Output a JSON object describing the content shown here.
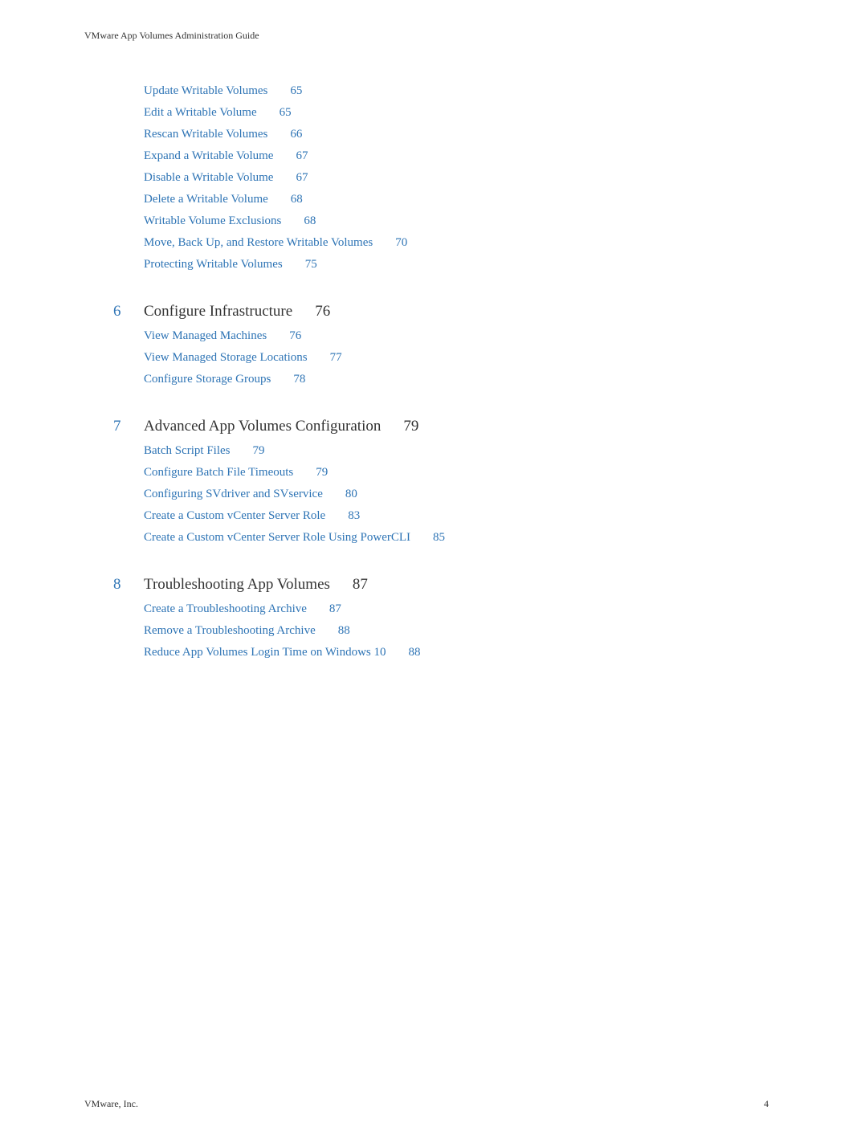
{
  "header": "VMware App Volumes Administration Guide",
  "orphan_items": [
    {
      "title": "Update Writable Volumes",
      "page": "65"
    },
    {
      "title": "Edit a Writable Volume",
      "page": "65"
    },
    {
      "title": "Rescan Writable Volumes",
      "page": "66"
    },
    {
      "title": "Expand a Writable Volume",
      "page": "67"
    },
    {
      "title": "Disable a Writable Volume",
      "page": "67"
    },
    {
      "title": "Delete a Writable Volume",
      "page": "68"
    },
    {
      "title": "Writable Volume Exclusions",
      "page": "68"
    },
    {
      "title": "Move, Back Up, and Restore Writable Volumes",
      "page": "70"
    },
    {
      "title": "Protecting Writable Volumes",
      "page": "75"
    }
  ],
  "chapters": [
    {
      "num": "6",
      "title": "Configure Infrastructure",
      "page": "76",
      "items": [
        {
          "title": "View Managed Machines",
          "page": "76"
        },
        {
          "title": "View Managed Storage Locations",
          "page": "77"
        },
        {
          "title": "Configure Storage Groups",
          "page": "78"
        }
      ]
    },
    {
      "num": "7",
      "title": "Advanced App Volumes Configuration",
      "page": "79",
      "items": [
        {
          "title": "Batch Script Files",
          "page": "79"
        },
        {
          "title": "Configure Batch File Timeouts",
          "page": "79"
        },
        {
          "title": "Configuring SVdriver and SVservice",
          "page": "80"
        },
        {
          "title": "Create a Custom vCenter Server Role",
          "page": "83"
        },
        {
          "title": "Create a Custom vCenter Server Role Using PowerCLI",
          "page": "85"
        }
      ]
    },
    {
      "num": "8",
      "title": "Troubleshooting App Volumes",
      "page": "87",
      "items": [
        {
          "title": "Create a Troubleshooting Archive",
          "page": "87"
        },
        {
          "title": "Remove a Troubleshooting Archive",
          "page": "88"
        },
        {
          "title": "Reduce App Volumes Login Time on Windows 10",
          "page": "88"
        }
      ]
    }
  ],
  "footer": {
    "left": "VMware, Inc.",
    "right": "4"
  }
}
